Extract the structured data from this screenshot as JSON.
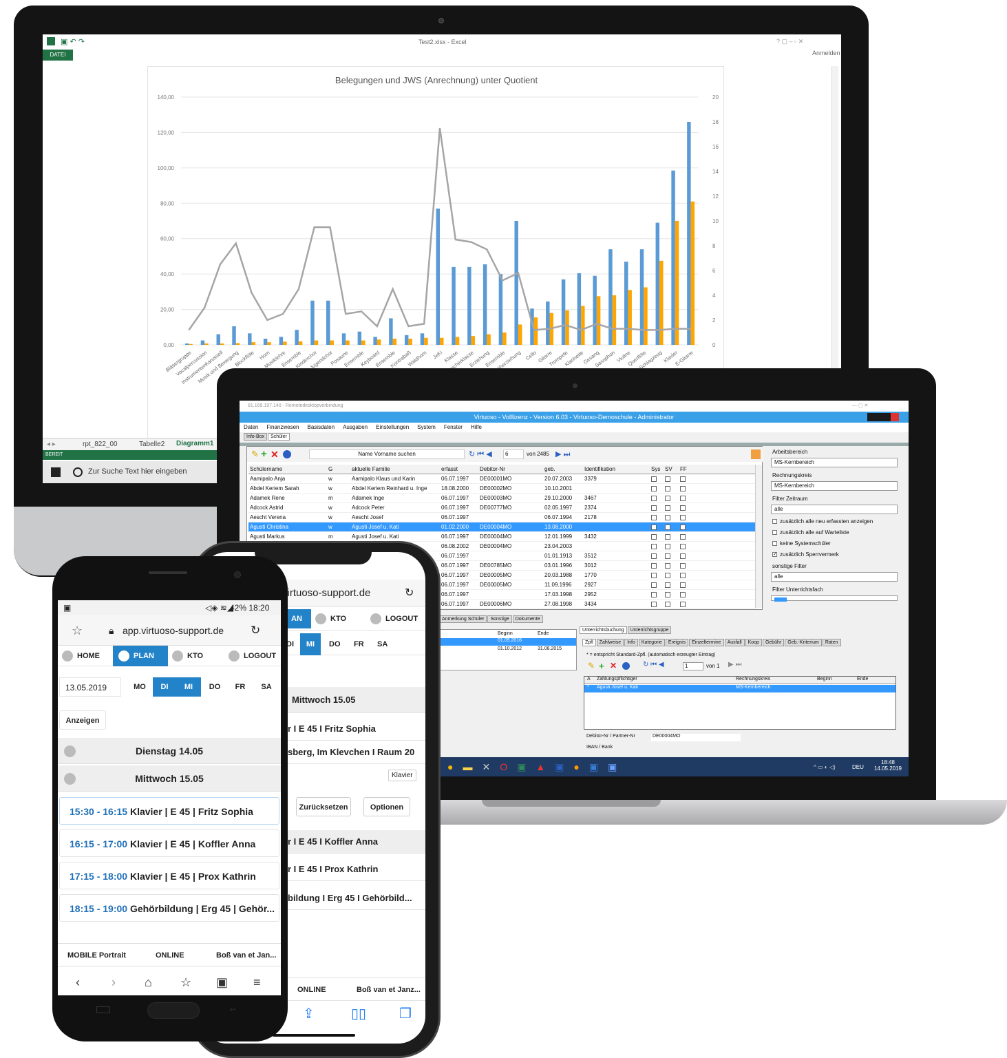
{
  "excel": {
    "file_label": "DATEI",
    "title": "Test2.xlsx - Excel",
    "signin": "Anmelden",
    "tabs": [
      "rpt_822_00",
      "Tabelle2",
      "Diagramm1"
    ],
    "status": "BEREIT",
    "search_placeholder": "Zur Suche Text hier eingeben"
  },
  "chart_data": {
    "type": "bar",
    "title": "Belegungen und JWS (Anrechnung) unter Quotient",
    "categories": [
      "Bläsergruppe",
      "Vocalpercussion",
      "Instrumentenkarussell",
      "Musik und Bewegung",
      "Blockflöte",
      "Horn",
      "Musiklehre",
      "Ensemble",
      "Kinderchor",
      "Jugendchor",
      "Posaune",
      "Ensemble",
      "Keyboard",
      "Ensemble",
      "Kontrabaß",
      "Waldhorn",
      "JeKi",
      "Klasse",
      "Streicherklasse",
      "Erziehung",
      "Ensemble",
      "Früherziehung",
      "Cello",
      "Gitarre",
      "Trompete",
      "Klarinette",
      "Gesang",
      "Saxophon",
      "Violine",
      "Querflöte",
      "Schlagzeug",
      "Klavier",
      "E-Gitarre"
    ],
    "series": [
      {
        "axis": "left",
        "color": "#5b9bd5",
        "values": [
          0.8,
          2.5,
          6,
          10.5,
          6.5,
          3.5,
          4.5,
          8.5,
          25,
          25,
          6.5,
          7.5,
          4.5,
          15,
          5.5,
          6.5,
          77,
          44,
          44,
          45.5,
          40,
          70,
          20.5,
          24.5,
          37,
          40.5,
          39,
          54,
          47,
          54,
          69,
          98.5,
          126
        ]
      },
      {
        "axis": "left",
        "color": "#ffa500",
        "values": [
          0.5,
          0.8,
          0.8,
          1,
          1.5,
          1.5,
          1.8,
          2,
          2.5,
          2.5,
          2.5,
          2.5,
          3,
          3.5,
          3.5,
          4,
          4,
          4.5,
          5,
          6,
          7,
          11.5,
          15.5,
          18,
          19.5,
          22,
          27.5,
          28,
          31,
          32.5,
          47.5,
          70,
          81
        ]
      },
      {
        "axis": "right",
        "color": "#a5a5a5",
        "values": [
          1.2,
          3,
          6.5,
          8.2,
          4.2,
          2,
          2.5,
          4.5,
          9.5,
          9.5,
          2.5,
          2.7,
          1.5,
          4.5,
          1.5,
          1.7,
          17.5,
          8.5,
          8.3,
          7.7,
          5.2,
          5.8,
          1.2,
          1.3,
          1.6,
          1.2,
          1.7,
          1.3,
          1.3,
          1.2,
          1.2,
          1.3,
          1.3
        ]
      }
    ],
    "ylim": [
      0,
      140
    ],
    "yticks": [
      "0,00",
      "20,00",
      "40,00",
      "60,00",
      "80,00",
      "100,00",
      "120,00",
      "140,00"
    ],
    "y2lim": [
      0,
      20
    ],
    "y2ticks": [
      "0",
      "2",
      "4",
      "6",
      "8",
      "10",
      "12",
      "14",
      "16",
      "18",
      "20"
    ]
  },
  "rdp": {
    "window_title": "81.169.197.140 - Remotedesktopverbindung",
    "app_title": "Virtuoso - Volllizenz - Version 6.03  -  Virtuoso-Demoschule - Administrator",
    "menu": [
      "Daten",
      "Finanzwesen",
      "Basisdaten",
      "Ausgaben",
      "Einstellungen",
      "System",
      "Fenster",
      "Hilfe"
    ],
    "tabs": [
      "Info-Box",
      "Schüler"
    ],
    "search_label": "Name Vorname suchen",
    "record_pos": "6",
    "record_total": "von 2485",
    "columns": [
      "Schülername",
      "G",
      "aktuelle Familie",
      "erfasst",
      "Debitor-Nr",
      "geb.",
      "Identifikation",
      "Sys",
      "SV",
      "FF"
    ],
    "rows": [
      [
        "Aamipalo Anja",
        "w",
        "Aamipalo Klaus und Karin",
        "06.07.1997",
        "DE00001MO",
        "20.07.2003",
        "3379"
      ],
      [
        "Abdel Keriem Sarah",
        "w",
        "Abdel Keriem Reinhard u. Inge",
        "18.08.2000",
        "DE00002MO",
        "10.10.2001",
        ""
      ],
      [
        "Adamek Rene",
        "m",
        "Adamek Inge",
        "06.07.1997",
        "DE00003MO",
        "29.10.2000",
        "3467"
      ],
      [
        "Adcock Astrid",
        "w",
        "Adcock Peter",
        "06.07.1997",
        "DE00777MO",
        "02.05.1997",
        "2374"
      ],
      [
        "Aescht Verena",
        "w",
        "Aescht Josef",
        "06.07.1997",
        "",
        "06.07.1994",
        "2178"
      ],
      [
        "Agusti Christina",
        "w",
        "Agusti Josef u. Kati",
        "01.02.2000",
        "DE00004MO",
        "13.08.2000",
        ""
      ],
      [
        "Agusti Markus",
        "m",
        "Agusti Josef u. Kati",
        "06.07.1997",
        "DE00004MO",
        "12.01.1999",
        "3432"
      ],
      [
        "",
        "",
        "",
        "06.08.2002",
        "DE00004MO",
        "23.04.2003",
        ""
      ],
      [
        "",
        "",
        "",
        "06.07.1997",
        "",
        "01.01.1913",
        "3512"
      ],
      [
        "",
        "",
        "",
        "06.07.1997",
        "DE00785MO",
        "03.01.1996",
        "3012"
      ],
      [
        "",
        "",
        "",
        "06.07.1997",
        "DE00005MO",
        "20.03.1988",
        "1770"
      ],
      [
        "",
        "",
        "",
        "06.07.1997",
        "DE00005MO",
        "11.09.1996",
        "2927"
      ],
      [
        "",
        "",
        "",
        "06.07.1997",
        "",
        "17.03.1998",
        "2952"
      ],
      [
        "",
        "",
        "",
        "06.07.1997",
        "DE00006MO",
        "27.08.1998",
        "3434"
      ]
    ],
    "right": {
      "arbeitsbereich_label": "Arbeitsbereich",
      "arbeitsbereich": "MS-Kernbereich",
      "rechnungskreis_label": "Rechnungskreis",
      "rechnungskreis": "MS-Kernbereich",
      "zeitraum_label": "Filter Zeitraum",
      "zeitraum": "alle",
      "checks": [
        "zusätzlich alle neu erfassten anzeigen",
        "zusätzlich alle auf Warteliste",
        "keine Systemschüler",
        "zusätzlich Sperrvermerk"
      ],
      "sonstige_label": "sonstige Filter",
      "sonstige": "alle",
      "fach_label": "Filter Unterrichtsfach"
    },
    "lower_tabs": [
      "Anmerkung Schüler",
      "Sonstige",
      "Dokumente"
    ],
    "booking_tabs": [
      "Unterrichtsbuchung",
      "Unterrichtsgruppe"
    ],
    "sub_tabs": [
      "Zpfl",
      "Zahlweise",
      "Info",
      "Kategorie",
      "Ereignis",
      "Einzeltermine",
      "Ausfall",
      "Koop",
      "Gebühr",
      "Geb.-Kriterium",
      "Raten"
    ],
    "zpfl_note": "* = entspricht Standard-Zpfl. (automatisch erzeugter Eintrag)",
    "zpfl_pos": "1",
    "zpfl_total": "von 1",
    "zpfl_cols": [
      "A",
      "Zahlungspflichtiger",
      "Rechnungskreis",
      "Beginn",
      "Ende"
    ],
    "zpfl_row": [
      "*",
      "Agusti Josef u. Kati",
      "MS-Kernbereich",
      "",
      ""
    ],
    "left_cols": [
      "Beginn",
      "Ende"
    ],
    "left_rows": [
      [
        "01.09.2016",
        ""
      ],
      [
        "01.10.2012",
        "31.08.2015"
      ]
    ],
    "debitor_label": "Debitor-Nr / Partner-Nr",
    "debitor": "DE00004MO",
    "iban_label": "IBAN / Bank",
    "clock_time": "18:48",
    "clock_date": "14.05.2019",
    "lang": "DEU"
  },
  "iphone": {
    "url": "virtuoso-support.de",
    "nav": [
      "AN",
      "KTO",
      "LOGOUT"
    ],
    "days": [
      "DI",
      "MI",
      "DO",
      "FR",
      "SA"
    ],
    "day_header": "Mittwoch 15.05",
    "items": [
      "r I E 45 I Fritz Sophia",
      "sberg, Im Klevchen I Raum 20"
    ],
    "tag": "Klavier",
    "buttons": [
      "Zurücksetzen",
      "Optionen"
    ],
    "items2": [
      "r I E 45 I Koffler Anna",
      "r I E 45 I Prox Kathrin",
      "bildung I Erg 45 I Gehörbild..."
    ],
    "footer": [
      "ONLINE",
      "Boß van et Janz..."
    ]
  },
  "android": {
    "status": "42%  18:20",
    "url": "app.virtuoso-support.de",
    "nav": [
      "HOME",
      "PLAN",
      "KTO",
      "LOGOUT"
    ],
    "date": "13.05.2019",
    "days": [
      "MO",
      "DI",
      "MI",
      "DO",
      "FR",
      "SA"
    ],
    "show_button": "Anzeigen",
    "day1": "Dienstag 14.05",
    "day2": "Mittwoch 15.05",
    "slots": [
      {
        "time": "15:30 - 16:15",
        "text": " Klavier | E 45 | Fritz Sophia"
      },
      {
        "time": "16:15 - 17:00",
        "text": " Klavier | E 45 | Koffler Anna"
      },
      {
        "time": "17:15 - 18:00",
        "text": " Klavier | E 45 | Prox Kathrin"
      },
      {
        "time": "18:15 - 19:00",
        "text": " Gehörbildung | Erg 45 | Gehör..."
      }
    ],
    "footer": [
      "MOBILE Portrait",
      "ONLINE",
      "Boß van et Jan..."
    ]
  }
}
